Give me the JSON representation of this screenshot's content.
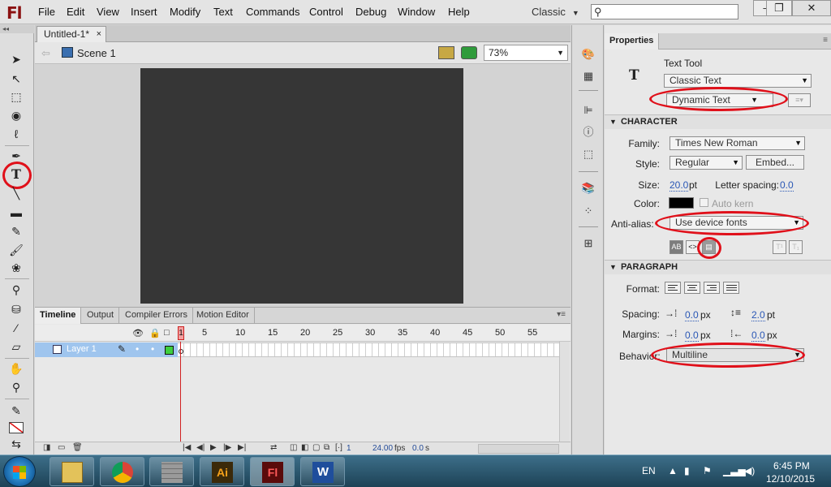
{
  "app": {
    "logo": "Fl"
  },
  "menu": [
    "File",
    "Edit",
    "View",
    "Insert",
    "Modify",
    "Text",
    "Commands",
    "Control",
    "Debug",
    "Window",
    "Help"
  ],
  "workspace": "Classic",
  "window_controls": {
    "minimize": "–",
    "restore": "❐",
    "close": "✕"
  },
  "document": {
    "tab_title": "Untitled-1*",
    "tab_close": "×",
    "scene": "Scene 1",
    "zoom": "73%"
  },
  "timeline": {
    "tabs": [
      "Timeline",
      "Output",
      "Compiler Errors",
      "Motion Editor"
    ],
    "frame_numbers": [
      "1",
      "5",
      "10",
      "15",
      "20",
      "25",
      "30",
      "35",
      "40",
      "45",
      "50",
      "55"
    ],
    "layer_name": "Layer 1",
    "fps_value": "24.00",
    "fps_unit": "fps",
    "time_value": "0.0",
    "time_unit": "s",
    "current_frame": "1"
  },
  "properties": {
    "panel_title": "Properties",
    "tool_name": "Text Tool",
    "tool_glyph": "T",
    "text_engine": "Classic Text",
    "text_type": "Dynamic Text",
    "character": {
      "header": "CHARACTER",
      "family_label": "Family:",
      "family": "Times New Roman",
      "style_label": "Style:",
      "style": "Regular",
      "embed_label": "Embed...",
      "size_label": "Size:",
      "size": "20.0",
      "size_unit": "pt",
      "letter_spacing_label": "Letter spacing:",
      "letter_spacing": "0.0",
      "color_label": "Color:",
      "color": "#000000",
      "auto_kern_label": "Auto kern",
      "anti_alias_label": "Anti-alias:",
      "anti_alias": "Use device fonts"
    },
    "paragraph": {
      "header": "PARAGRAPH",
      "format_label": "Format:",
      "spacing_label": "Spacing:",
      "spacing_indent": "0.0",
      "spacing_indent_unit": "px",
      "line_spacing": "2.0",
      "line_spacing_unit": "pt",
      "margins_label": "Margins:",
      "margin_left": "0.0",
      "margin_left_unit": "px",
      "margin_right": "0.0",
      "margin_right_unit": "px",
      "behavior_label": "Behavior:",
      "behavior": "Multiline"
    }
  },
  "taskbar": {
    "language": "EN",
    "time": "6:45 PM",
    "date": "12/10/2015"
  },
  "colors": {
    "stage": "#363636",
    "annotation_red": "#e0101a",
    "layer_selected": "#9fc5ee"
  }
}
